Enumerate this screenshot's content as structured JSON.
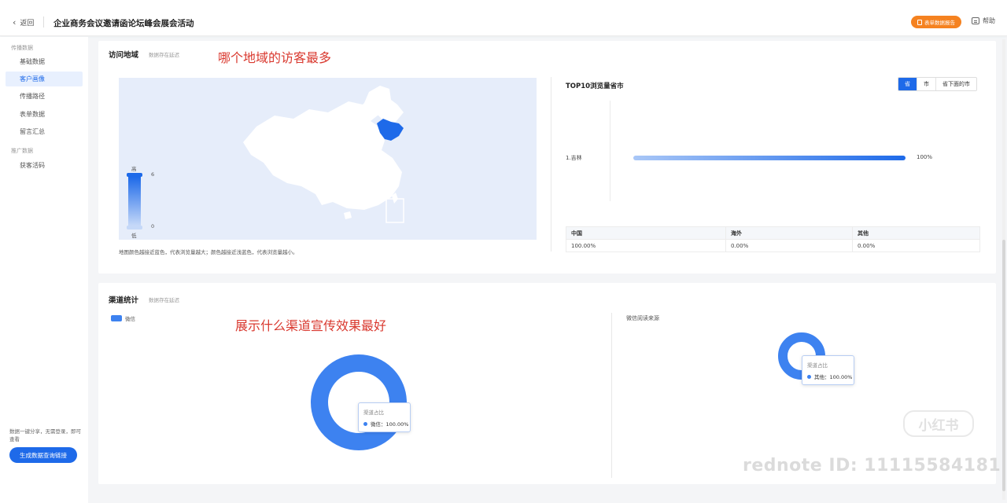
{
  "header": {
    "back_label": "返回",
    "title": "企业商务会议邀请函论坛峰会展会活动",
    "report_button": "表单数据报告",
    "help_label": "帮助"
  },
  "sidebar": {
    "groups": [
      {
        "label": "传播数据",
        "items": [
          {
            "label": "基础数据",
            "active": false
          },
          {
            "label": "客户画像",
            "active": true
          },
          {
            "label": "传播路径",
            "active": false
          },
          {
            "label": "表单数据",
            "active": false
          },
          {
            "label": "留言汇总",
            "active": false
          }
        ]
      },
      {
        "label": "推广数据",
        "items": [
          {
            "label": "获客活码",
            "active": false
          }
        ]
      }
    ],
    "note": "数据一键分享，无需登录，即可查看",
    "generate_button": "生成数据查询链接"
  },
  "visit_region": {
    "title": "访问地域",
    "subtitle": "数据存在延迟",
    "annotation": "哪个地域的访客最多",
    "map_legend": {
      "high_label": "高",
      "low_label": "低",
      "max": "6",
      "min": "0"
    },
    "map_note": "地图颜色越接近蓝色，代表浏览量越大；颜色越接近浅蓝色，代表浏览量越小。",
    "highlight_region": "吉林",
    "highlight_color": "#1e6ae9",
    "top10": {
      "title": "TOP10浏览量省市",
      "tabs": [
        {
          "label": "省",
          "active": true
        },
        {
          "label": "市",
          "active": false
        },
        {
          "label": "省下面的市",
          "active": false
        }
      ],
      "ranks": [
        {
          "label": "1.吉林",
          "value_text": "100%",
          "share": 1.0
        }
      ]
    },
    "region_table": {
      "headers": [
        "中国",
        "海外",
        "其他"
      ],
      "rows": [
        [
          "100.00%",
          "0.00%",
          "0.00%"
        ]
      ]
    }
  },
  "channel": {
    "title": "渠道统计",
    "subtitle": "数据存在延迟",
    "annotation": "展示什么渠道宣传效果最好",
    "legend": [
      {
        "label": "微信",
        "color": "#3d82f0"
      }
    ],
    "left_tooltip": {
      "title": "渠道占比",
      "row": "微信：100.00%"
    },
    "right_title": "微信阅读来源",
    "right_tooltip": {
      "title": "渠道占比",
      "row": "其他：100.00%"
    },
    "donut_color": "#3d82f0"
  },
  "watermark": {
    "logo_text": "小红书",
    "id_text": "rednote ID: 11115584181"
  },
  "colors": {
    "accent": "#1e6ae9",
    "orange": "#f58220",
    "annotation": "#d9382e"
  }
}
